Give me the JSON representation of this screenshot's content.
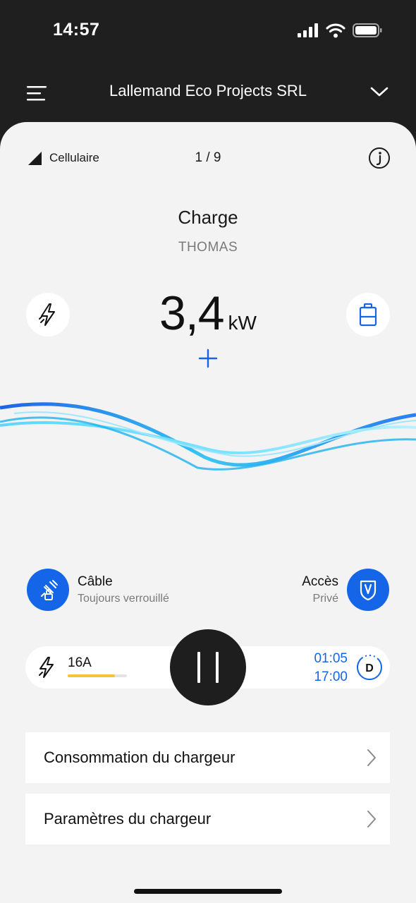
{
  "status_bar": {
    "time": "14:57"
  },
  "app_bar": {
    "title": "Lallemand Eco Projects SRL"
  },
  "card": {
    "connection": "Cellulaire",
    "pager": "1 / 9",
    "title": "Charge",
    "user": "THOMAS",
    "power_value": "3,4",
    "power_unit": "kW"
  },
  "features": {
    "cable": {
      "title": "Câble",
      "subtitle": "Toujours verrouillé"
    },
    "access": {
      "title": "Accès",
      "subtitle": "Privé"
    }
  },
  "control": {
    "current": "16A",
    "current_level": 0.8,
    "start_time": "01:05",
    "end_time": "17:00",
    "mode_badge": "D"
  },
  "rows": [
    {
      "label": "Consommation du chargeur"
    },
    {
      "label": "Paramètres du chargeur"
    }
  ],
  "icons": {
    "menu": "menu-icon",
    "chevron": "chevron-down-icon",
    "info": "info-icon",
    "bolt": "lightning-icon",
    "battery": "battery-icon",
    "plus": "plus-icon",
    "cable": "cable-lock-icon",
    "access": "shield-icon",
    "pause": "pause-icon"
  },
  "colors": {
    "accent": "#1565e8",
    "amp_bar": "#f2c531",
    "dark": "#1f1f1f"
  }
}
